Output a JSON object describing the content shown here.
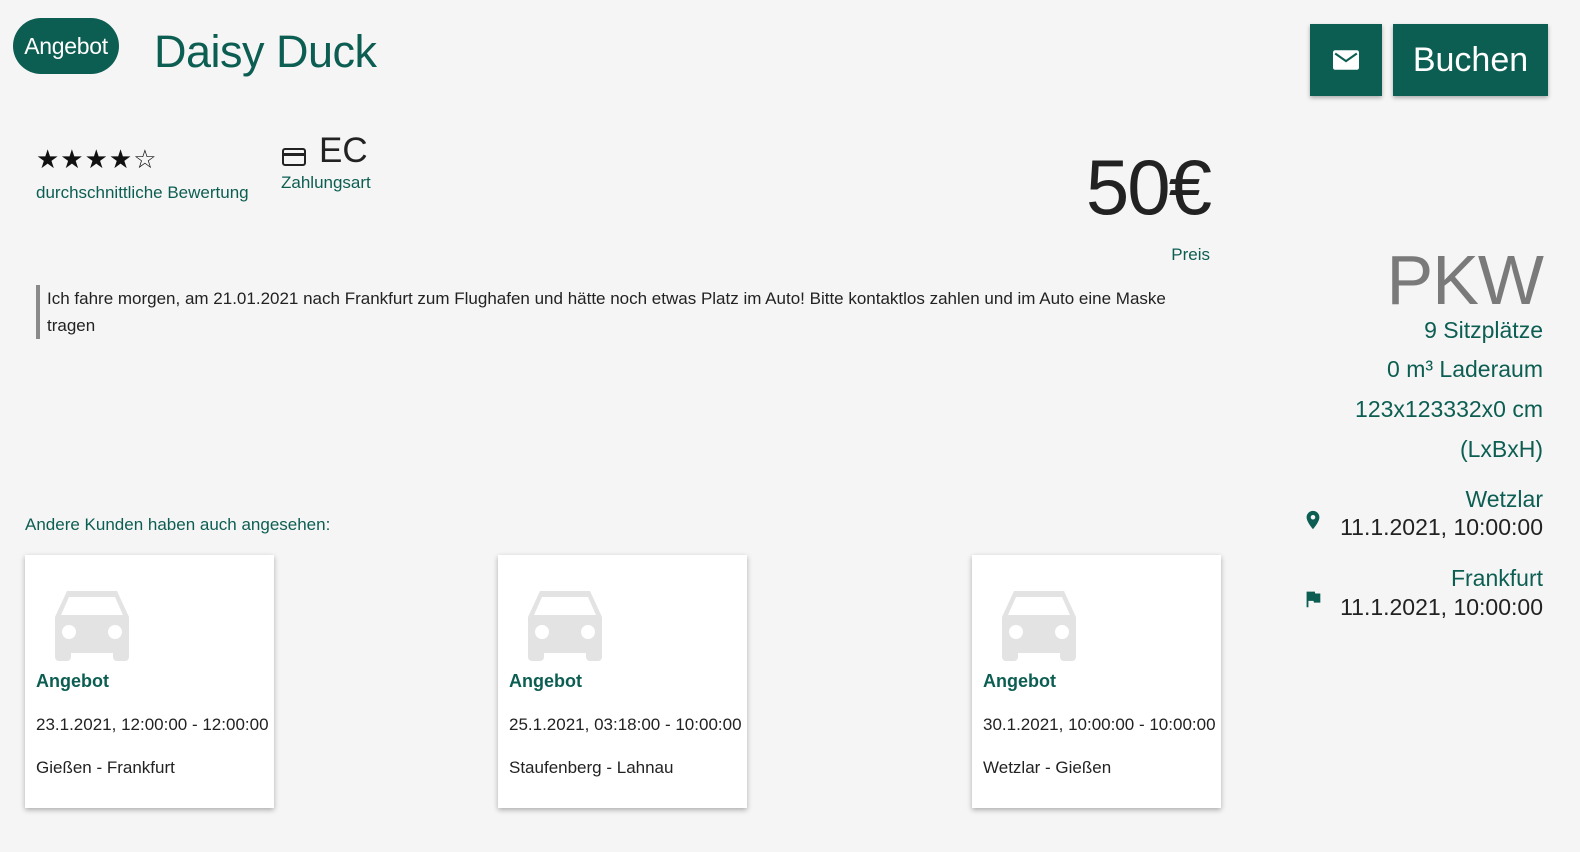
{
  "header": {
    "type_chip": "Angebot",
    "name": "Daisy Duck",
    "mail_icon": "mail-icon",
    "book_label": "Buchen"
  },
  "rating": {
    "stars_display": "★★★★☆",
    "value": 4,
    "max": 5,
    "label": "durchschnittliche Bewertung"
  },
  "payment": {
    "icon": "credit-card-icon",
    "value": "EC",
    "label": "Zahlungsart"
  },
  "price": {
    "value": "50€",
    "label": "Preis"
  },
  "description": "Ich fahre morgen, am 21.01.2021 nach Frankfurt zum Flughafen und hätte noch etwas Platz im Auto! Bitte kontaktlos zahlen und im Auto eine Maske tragen",
  "vehicle": {
    "type": "PKW",
    "seats": "9 Sitzplätze",
    "cargo": "0 m³ Laderaum",
    "dimensions": "123x123332x0 cm",
    "dimensions_unit": "(LxBxH)"
  },
  "route": {
    "start": {
      "icon": "location-pin-icon",
      "place": "Wetzlar",
      "time": "11.1.2021, 10:00:00"
    },
    "end": {
      "icon": "flag-icon",
      "place": "Frankfurt",
      "time": "11.1.2021, 10:00:00"
    }
  },
  "related": {
    "label": "Andere Kunden haben auch angesehen:",
    "cards": [
      {
        "icon": "car-icon",
        "type": "Angebot",
        "date": "23.1.2021, 12:00:00 - 12:00:00",
        "route": "Gießen - Frankfurt"
      },
      {
        "icon": "car-icon",
        "type": "Angebot",
        "date": "25.1.2021, 03:18:00 - 10:00:00",
        "route": "Staufenberg - Lahnau"
      },
      {
        "icon": "car-icon",
        "type": "Angebot",
        "date": "30.1.2021, 10:00:00 - 10:00:00",
        "route": "Wetzlar - Gießen"
      }
    ]
  },
  "colors": {
    "accent": "#0d5e52",
    "background": "#f5f5f5",
    "muted": "#7a7a7a"
  }
}
